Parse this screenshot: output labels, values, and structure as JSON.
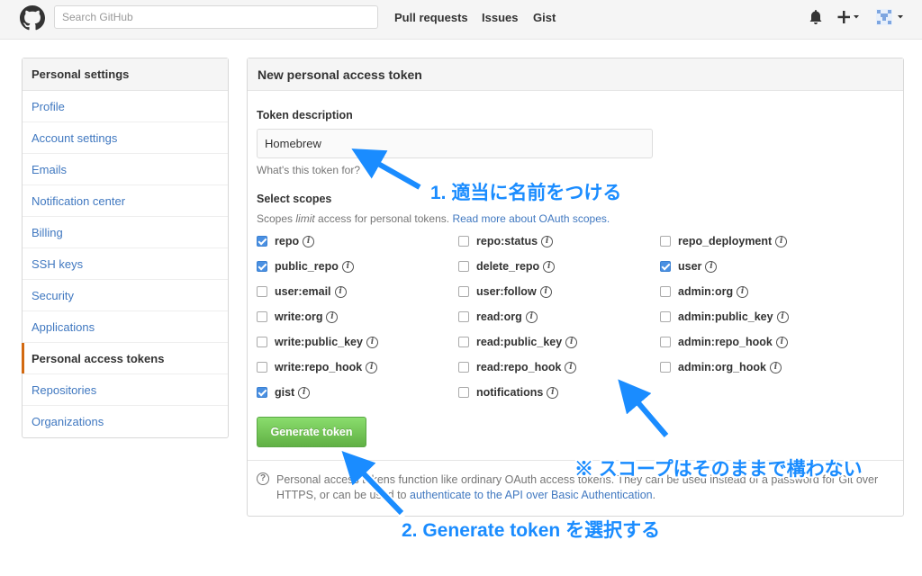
{
  "header": {
    "search_placeholder": "Search GitHub",
    "nav": [
      "Pull requests",
      "Issues",
      "Gist"
    ],
    "icons": [
      "octocat-icon",
      "bell-icon",
      "plus-icon",
      "avatar"
    ]
  },
  "sidebar": {
    "title": "Personal settings",
    "items": [
      {
        "label": "Profile"
      },
      {
        "label": "Account settings"
      },
      {
        "label": "Emails"
      },
      {
        "label": "Notification center"
      },
      {
        "label": "Billing"
      },
      {
        "label": "SSH keys"
      },
      {
        "label": "Security"
      },
      {
        "label": "Applications"
      },
      {
        "label": "Personal access tokens",
        "selected": true
      },
      {
        "label": "Repositories"
      },
      {
        "label": "Organizations"
      }
    ]
  },
  "main": {
    "title": "New personal access token",
    "token_description_label": "Token description",
    "token_description_value": "Homebrew",
    "token_description_hint": "What's this token for?",
    "scopes_label": "Select scopes",
    "scopes_hint_prefix": "Scopes ",
    "scopes_hint_em": "limit",
    "scopes_hint_mid": " access for personal tokens. ",
    "scopes_hint_link": "Read more about OAuth scopes.",
    "scopes": [
      [
        "repo",
        true
      ],
      [
        "repo:status",
        false
      ],
      [
        "repo_deployment",
        false
      ],
      [
        "public_repo",
        true
      ],
      [
        "delete_repo",
        false
      ],
      [
        "user",
        true
      ],
      [
        "user:email",
        false
      ],
      [
        "user:follow",
        false
      ],
      [
        "admin:org",
        false
      ],
      [
        "write:org",
        false
      ],
      [
        "read:org",
        false
      ],
      [
        "admin:public_key",
        false
      ],
      [
        "write:public_key",
        false
      ],
      [
        "read:public_key",
        false
      ],
      [
        "admin:repo_hook",
        false
      ],
      [
        "write:repo_hook",
        false
      ],
      [
        "read:repo_hook",
        false
      ],
      [
        "admin:org_hook",
        false
      ],
      [
        "gist",
        true
      ],
      [
        "notifications",
        false
      ]
    ],
    "generate_button": "Generate token",
    "footer_text_1": "Personal access tokens function like ordinary OAuth access tokens. They can be used instead of a password for Git over HTTPS, or can be used to ",
    "footer_link": "authenticate to the API over Basic Authentication",
    "footer_text_2": "."
  },
  "annotations": {
    "step1": "1. 適当に名前をつける",
    "note": "※ スコープはそのままで構わない",
    "step2": "2. Generate token を選択する"
  },
  "colors": {
    "link": "#4078c0",
    "selected_marker": "#d26911",
    "button_green": "#60b044",
    "annotation_blue": "#1a8cff"
  }
}
